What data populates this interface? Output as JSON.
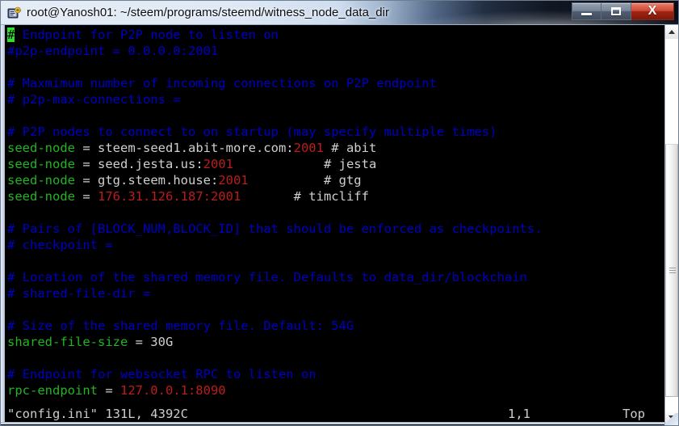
{
  "window": {
    "title": "root@Yanosh01: ~/steem/programs/steemd/witness_node_data_dir",
    "icon_name": "putty-terminal-icon",
    "buttons": {
      "minimize": "—",
      "maximize": "□",
      "close": "X"
    },
    "colors": {
      "comment": "#0000c4",
      "key": "#22b422",
      "value": "#cfcfcf",
      "number": "#bb1c1c",
      "cursor": "#2ee02e",
      "background": "#000000",
      "titlebar_light": "#e4ecf6",
      "titlebar_dark": "#080c16",
      "close_button": "#cf4b34"
    }
  },
  "editor": {
    "name": "vim",
    "lines": [
      {
        "n": 1,
        "segments": [
          {
            "t": "#",
            "c": "cursor"
          },
          {
            "t": " Endpoint for P2P node to listen on",
            "c": "comment"
          }
        ]
      },
      {
        "n": 2,
        "segments": [
          {
            "t": "#p2p-endpoint = 0.0.0.0:2001",
            "c": "comment"
          }
        ]
      },
      {
        "n": 3,
        "segments": []
      },
      {
        "n": 4,
        "segments": [
          {
            "t": "# Maxmimum number of incoming connections on P2P endpoint",
            "c": "comment"
          }
        ]
      },
      {
        "n": 5,
        "segments": [
          {
            "t": "# p2p-max-connections =",
            "c": "comment"
          }
        ]
      },
      {
        "n": 6,
        "segments": []
      },
      {
        "n": 7,
        "segments": [
          {
            "t": "# P2P nodes to connect to on startup (may specify multiple times)",
            "c": "comment"
          }
        ]
      },
      {
        "n": 8,
        "segments": [
          {
            "t": "seed-node",
            "c": "key"
          },
          {
            "t": " = ",
            "c": "value"
          },
          {
            "t": "steem-seed1.abit-more.com:",
            "c": "value"
          },
          {
            "t": "2001",
            "c": "number"
          },
          {
            "t": " # abit",
            "c": "value"
          }
        ]
      },
      {
        "n": 9,
        "segments": [
          {
            "t": "seed-node",
            "c": "key"
          },
          {
            "t": " = ",
            "c": "value"
          },
          {
            "t": "seed.jesta.us:",
            "c": "value"
          },
          {
            "t": "2001",
            "c": "number"
          },
          {
            "t": "            # jesta",
            "c": "value"
          }
        ]
      },
      {
        "n": 10,
        "segments": [
          {
            "t": "seed-node",
            "c": "key"
          },
          {
            "t": " = ",
            "c": "value"
          },
          {
            "t": "gtg.steem.house:",
            "c": "value"
          },
          {
            "t": "2001",
            "c": "number"
          },
          {
            "t": "          # gtg",
            "c": "value"
          }
        ]
      },
      {
        "n": 11,
        "segments": [
          {
            "t": "seed-node",
            "c": "key"
          },
          {
            "t": " = ",
            "c": "value"
          },
          {
            "t": "176.31.126.187:2001",
            "c": "number"
          },
          {
            "t": "       # timcliff",
            "c": "value"
          }
        ]
      },
      {
        "n": 12,
        "segments": []
      },
      {
        "n": 13,
        "segments": [
          {
            "t": "# Pairs of [BLOCK_NUM,BLOCK_ID] that should be enforced as checkpoints.",
            "c": "comment"
          }
        ]
      },
      {
        "n": 14,
        "segments": [
          {
            "t": "# checkpoint =",
            "c": "comment"
          }
        ]
      },
      {
        "n": 15,
        "segments": []
      },
      {
        "n": 16,
        "segments": [
          {
            "t": "# Location of the shared memory file. Defaults to data_dir/blockchain",
            "c": "comment"
          }
        ]
      },
      {
        "n": 17,
        "segments": [
          {
            "t": "# shared-file-dir =",
            "c": "comment"
          }
        ]
      },
      {
        "n": 18,
        "segments": []
      },
      {
        "n": 19,
        "segments": [
          {
            "t": "# Size of the shared memory file. Default: 54G",
            "c": "comment"
          }
        ]
      },
      {
        "n": 20,
        "segments": [
          {
            "t": "shared-file-size",
            "c": "key"
          },
          {
            "t": " = 30G",
            "c": "value"
          }
        ]
      },
      {
        "n": 21,
        "segments": []
      },
      {
        "n": 22,
        "segments": [
          {
            "t": "# Endpoint for websocket RPC to listen on",
            "c": "comment"
          }
        ]
      },
      {
        "n": 23,
        "segments": [
          {
            "t": "rpc-endpoint",
            "c": "key"
          },
          {
            "t": " = ",
            "c": "value"
          },
          {
            "t": "127.0.0.1:8090",
            "c": "number"
          }
        ]
      }
    ],
    "status": {
      "file": "\"config.ini\" 131L, 4392C",
      "position": "1,1",
      "relative": "Top"
    }
  },
  "scrollbar": {
    "up_arrow": "scroll-up-arrow-icon",
    "down_arrow": "scroll-down-arrow-icon",
    "thumb_label": "scrollbar-thumb"
  }
}
